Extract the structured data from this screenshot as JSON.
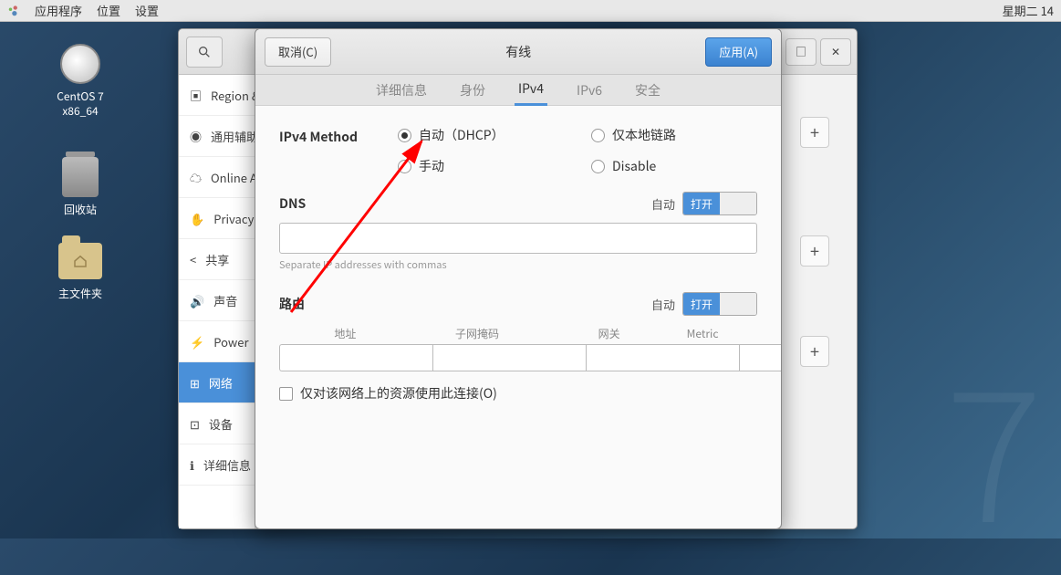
{
  "menubar": {
    "apps": "应用程序",
    "places": "位置",
    "settings": "设置",
    "clock": "星期二 14"
  },
  "desktop": {
    "disc_l1": "CentOS 7",
    "disc_l2": "x86_64",
    "trash": "回收站",
    "home": "主文件夹"
  },
  "bgwin": {
    "list": [
      {
        "icon": "camera",
        "label": "Region & Language"
      },
      {
        "icon": "accessibility",
        "label": "通用辅助"
      },
      {
        "icon": "cloud",
        "label": "Online Accounts"
      },
      {
        "icon": "hand",
        "label": "Privacy"
      },
      {
        "icon": "share",
        "label": "共享"
      },
      {
        "icon": "sound",
        "label": "声音"
      },
      {
        "icon": "power",
        "label": "Power"
      },
      {
        "icon": "network",
        "label": "网络",
        "sel": true
      },
      {
        "icon": "devices",
        "label": "设备"
      },
      {
        "icon": "info",
        "label": "详细信息"
      }
    ]
  },
  "dlg": {
    "cancel": "取消(C)",
    "apply": "应用(A)",
    "title": "有线",
    "tabs": {
      "details": "详细信息",
      "identity": "身份",
      "ipv4": "IPv4",
      "ipv6": "IPv6",
      "security": "安全"
    },
    "ipv4": {
      "method_label": "IPv4 Method",
      "opts": {
        "auto": "自动（DHCP）",
        "local": "仅本地链路",
        "manual": "手动",
        "disable": "Disable"
      },
      "dns_label": "DNS",
      "auto_label": "自动",
      "toggle_on": "打开",
      "dns_hint": "Separate IP addresses with commas",
      "routes_label": "路由",
      "route_cols": {
        "addr": "地址",
        "mask": "子网掩码",
        "gw": "网关",
        "metric": "Metric"
      },
      "only_this": "仅对该网络上的资源使用此连接(O)"
    }
  }
}
